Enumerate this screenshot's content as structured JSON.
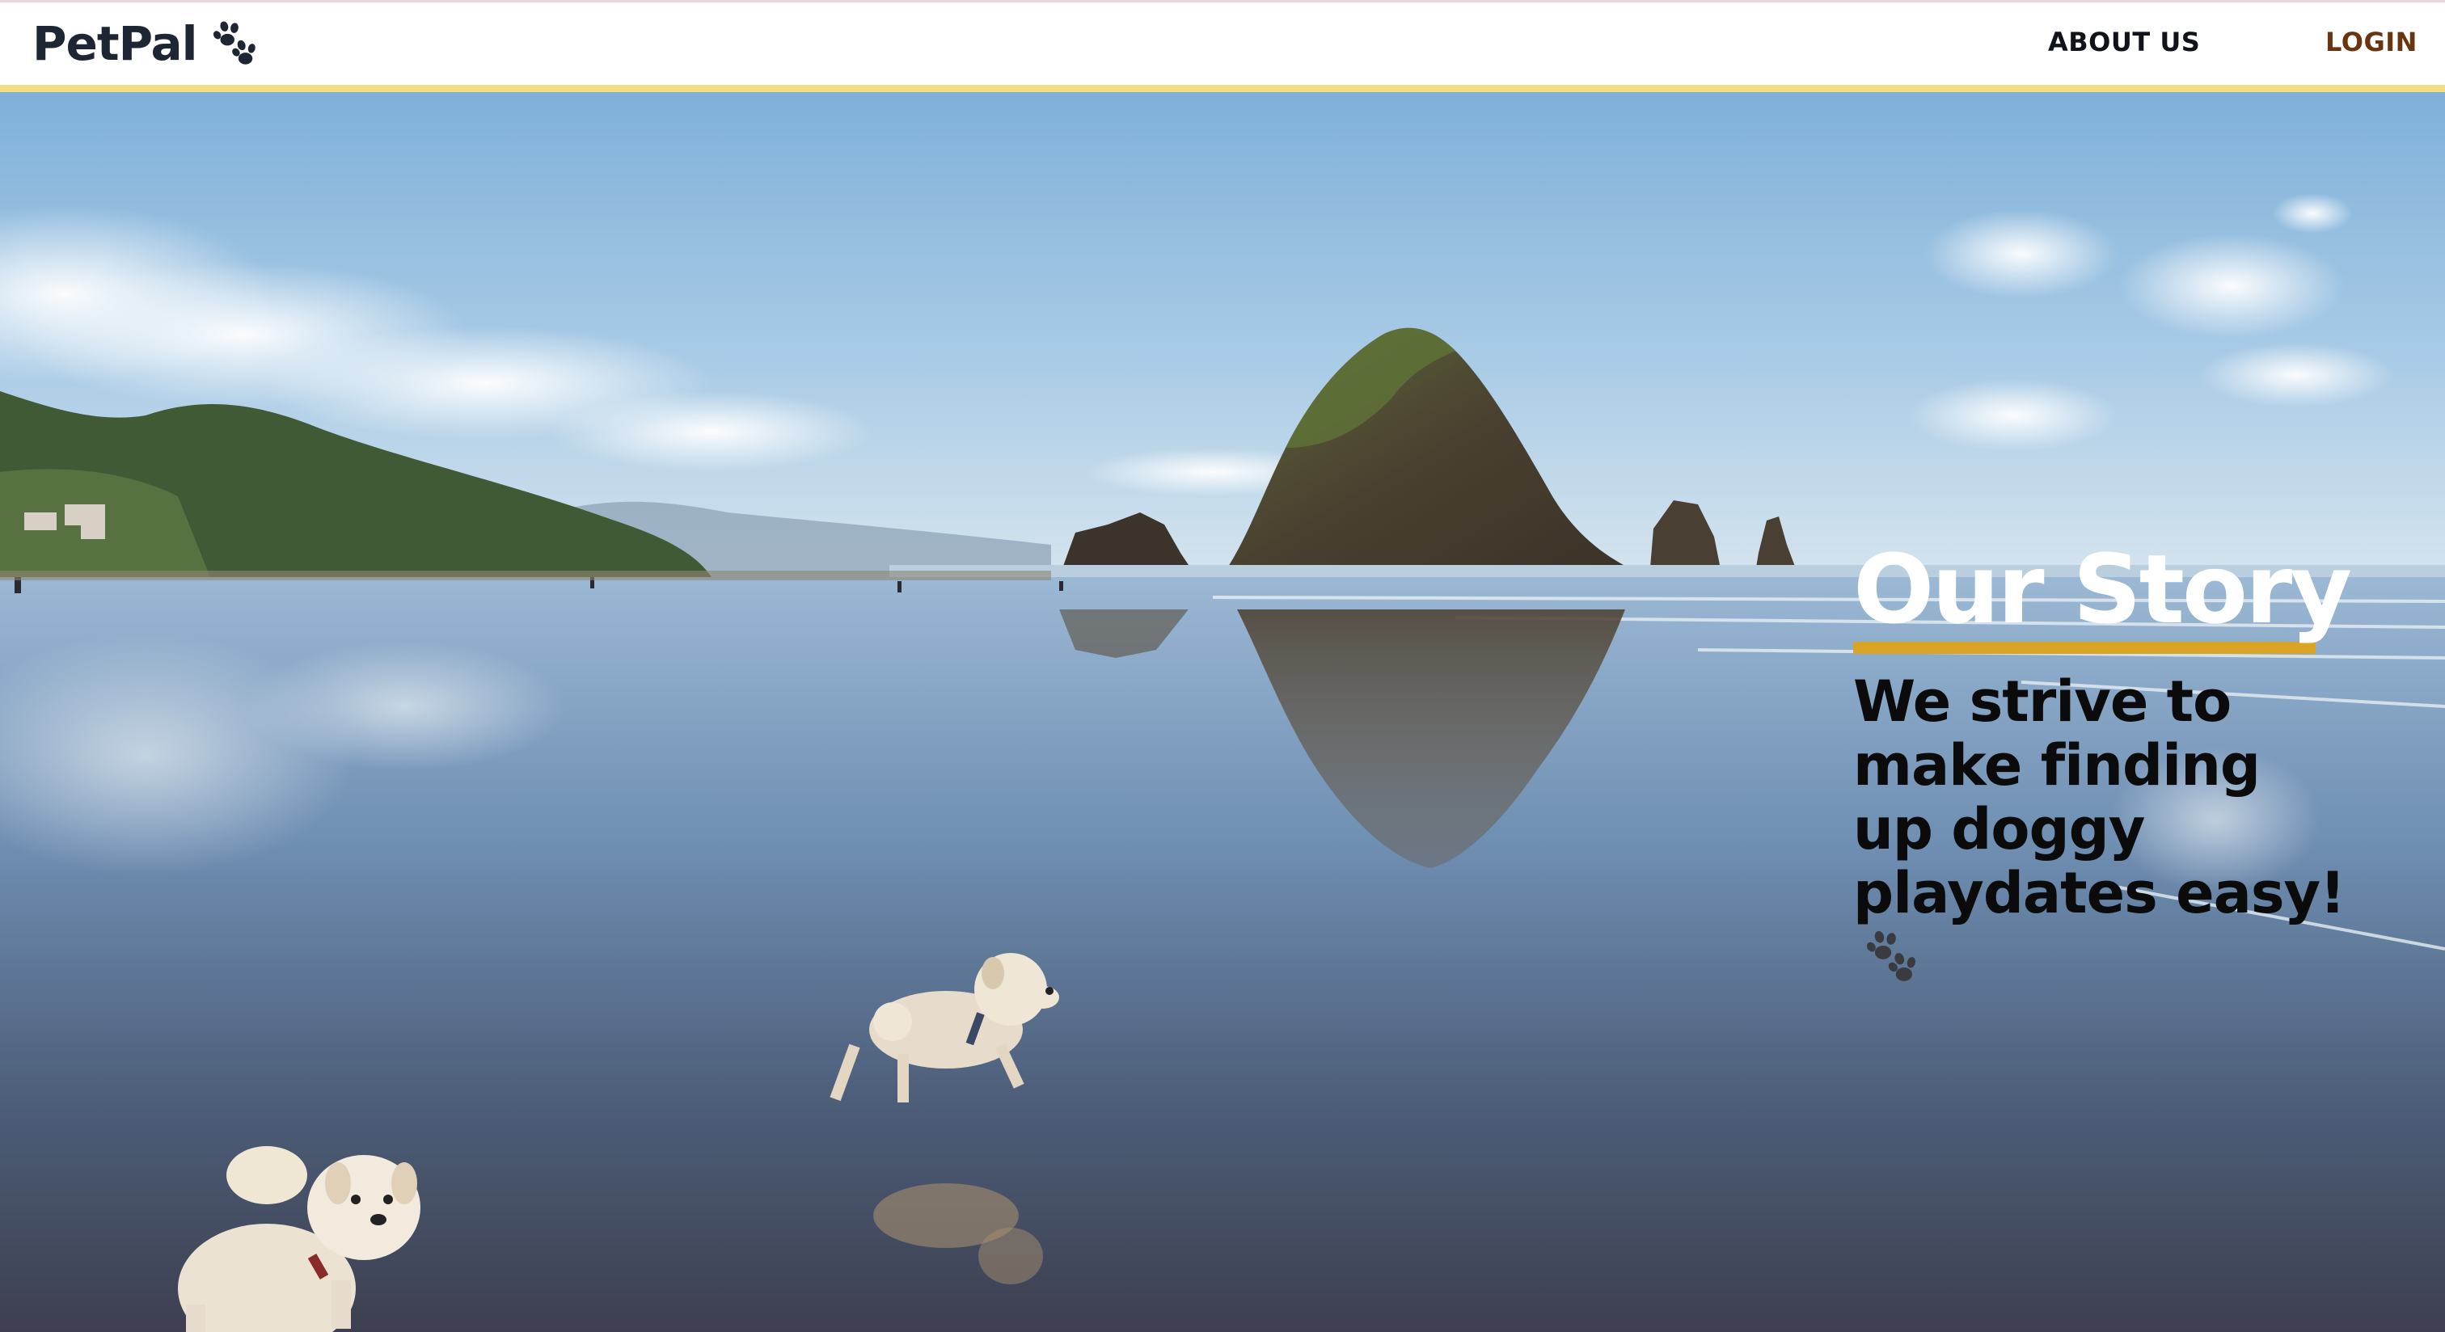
{
  "navbar": {
    "brand": "PetPal",
    "brand_icon": "paw-icon",
    "links": {
      "about": "ABOUT US",
      "login": "LOGIN"
    }
  },
  "hero": {
    "background": "beach-with-sea-stack-and-dogs-photo",
    "title": "Our Story",
    "tagline": "We strive to make finding up doggy playdates easy!",
    "tagline_icon": "paw-icon"
  },
  "colors": {
    "brand_text": "#1e2533",
    "login_link": "#6b3410",
    "navbar_border": "#f3dc84",
    "title_underline": "#d9a326",
    "title_text": "#ffffff",
    "tagline_text": "#0b0b0b"
  }
}
